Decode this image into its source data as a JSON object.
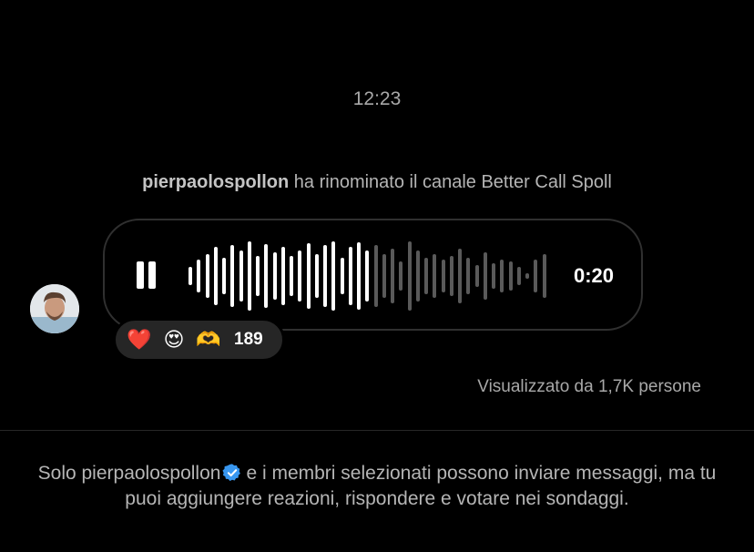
{
  "chat": {
    "timestamp": "12:23",
    "system_message": {
      "username": "pierpaolospollon",
      "text": "ha rinominato il canale Better Call Spoll"
    }
  },
  "voice_message": {
    "duration": "0:20",
    "state": "playing",
    "played_fraction": 0.5,
    "played_color": "#ffffff",
    "unplayed_color": "#5a5a5a",
    "waveform_levels": [
      0.25,
      0.45,
      0.6,
      0.8,
      0.5,
      0.85,
      0.7,
      0.95,
      0.55,
      0.88,
      0.65,
      0.8,
      0.55,
      0.7,
      0.9,
      0.6,
      0.85,
      0.95,
      0.5,
      0.8,
      0.92,
      0.7,
      0.85,
      0.6,
      0.75,
      0.4,
      0.95,
      0.7,
      0.5,
      0.6,
      0.45,
      0.55,
      0.75,
      0.5,
      0.3,
      0.65,
      0.35,
      0.45,
      0.4,
      0.25,
      0.08,
      0.45,
      0.6
    ]
  },
  "reactions": {
    "emojis": [
      "❤️",
      "😍",
      "🫶"
    ],
    "count": "189"
  },
  "seen_by": "Visualizzato da 1,7K persone",
  "footer": {
    "prefix": "Solo pierpaolospollon",
    "suffix": "e i membri selezionati possono inviare messaggi, ma tu puoi aggiungere reazioni, rispondere e votare nei sondaggi."
  },
  "colors": {
    "background": "#000000",
    "bubble_border": "#303030",
    "reaction_pill": "#262626",
    "verified_badge": "#3897f0"
  }
}
